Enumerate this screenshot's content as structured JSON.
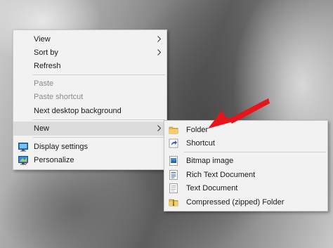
{
  "context_menu": {
    "view": "View",
    "sort_by": "Sort by",
    "refresh": "Refresh",
    "paste": "Paste",
    "paste_shortcut": "Paste shortcut",
    "next_desktop_background": "Next desktop background",
    "new": "New",
    "display_settings": "Display settings",
    "personalize": "Personalize"
  },
  "new_submenu": {
    "folder": "Folder",
    "shortcut": "Shortcut",
    "bitmap_image": "Bitmap image",
    "rich_text_document": "Rich Text Document",
    "text_document": "Text Document",
    "compressed_folder": "Compressed (zipped) Folder"
  },
  "icons": {
    "display_settings": "display-settings-icon",
    "personalize": "personalize-icon",
    "folder": "folder-icon",
    "shortcut": "shortcut-icon",
    "bitmap_image": "bitmap-image-icon",
    "rich_text_document": "rich-text-document-icon",
    "text_document": "text-document-icon",
    "compressed_folder": "zip-folder-icon"
  },
  "colors": {
    "annotation_arrow": "#e8141b",
    "menu_background": "#f2f2f2",
    "selected_item": "#dcdcdc",
    "disabled_text": "#8a8a8a"
  }
}
